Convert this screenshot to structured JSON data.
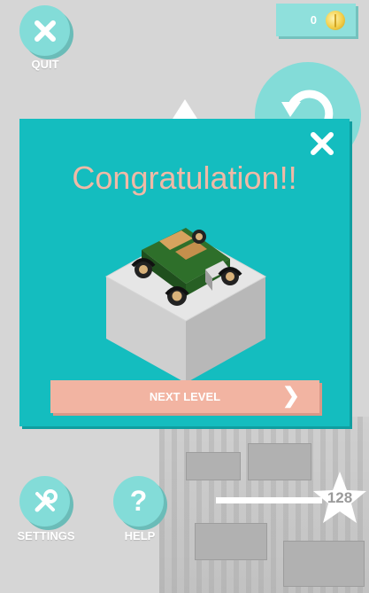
{
  "hud": {
    "quit_label": "QUIT",
    "coins": "0",
    "settings_label": "SETTINGS",
    "help_label": "HELP",
    "help_glyph": "?",
    "level_number": "128"
  },
  "modal": {
    "title": "Congratulation!!",
    "next_label": "NEXT LEVEL"
  },
  "icons": {
    "quit": "close-icon",
    "coin": "coin-icon",
    "refresh": "refresh-icon",
    "settings": "wrench-screwdriver-icon",
    "help": "question-icon",
    "modal_close": "close-icon",
    "next": "chevron-right-icon",
    "level": "star-icon"
  },
  "colors": {
    "modal_bg": "#14bdbf",
    "button_teal": "#83dcd8",
    "title": "#f0b9a6",
    "next_button": "#f2b4a2"
  }
}
